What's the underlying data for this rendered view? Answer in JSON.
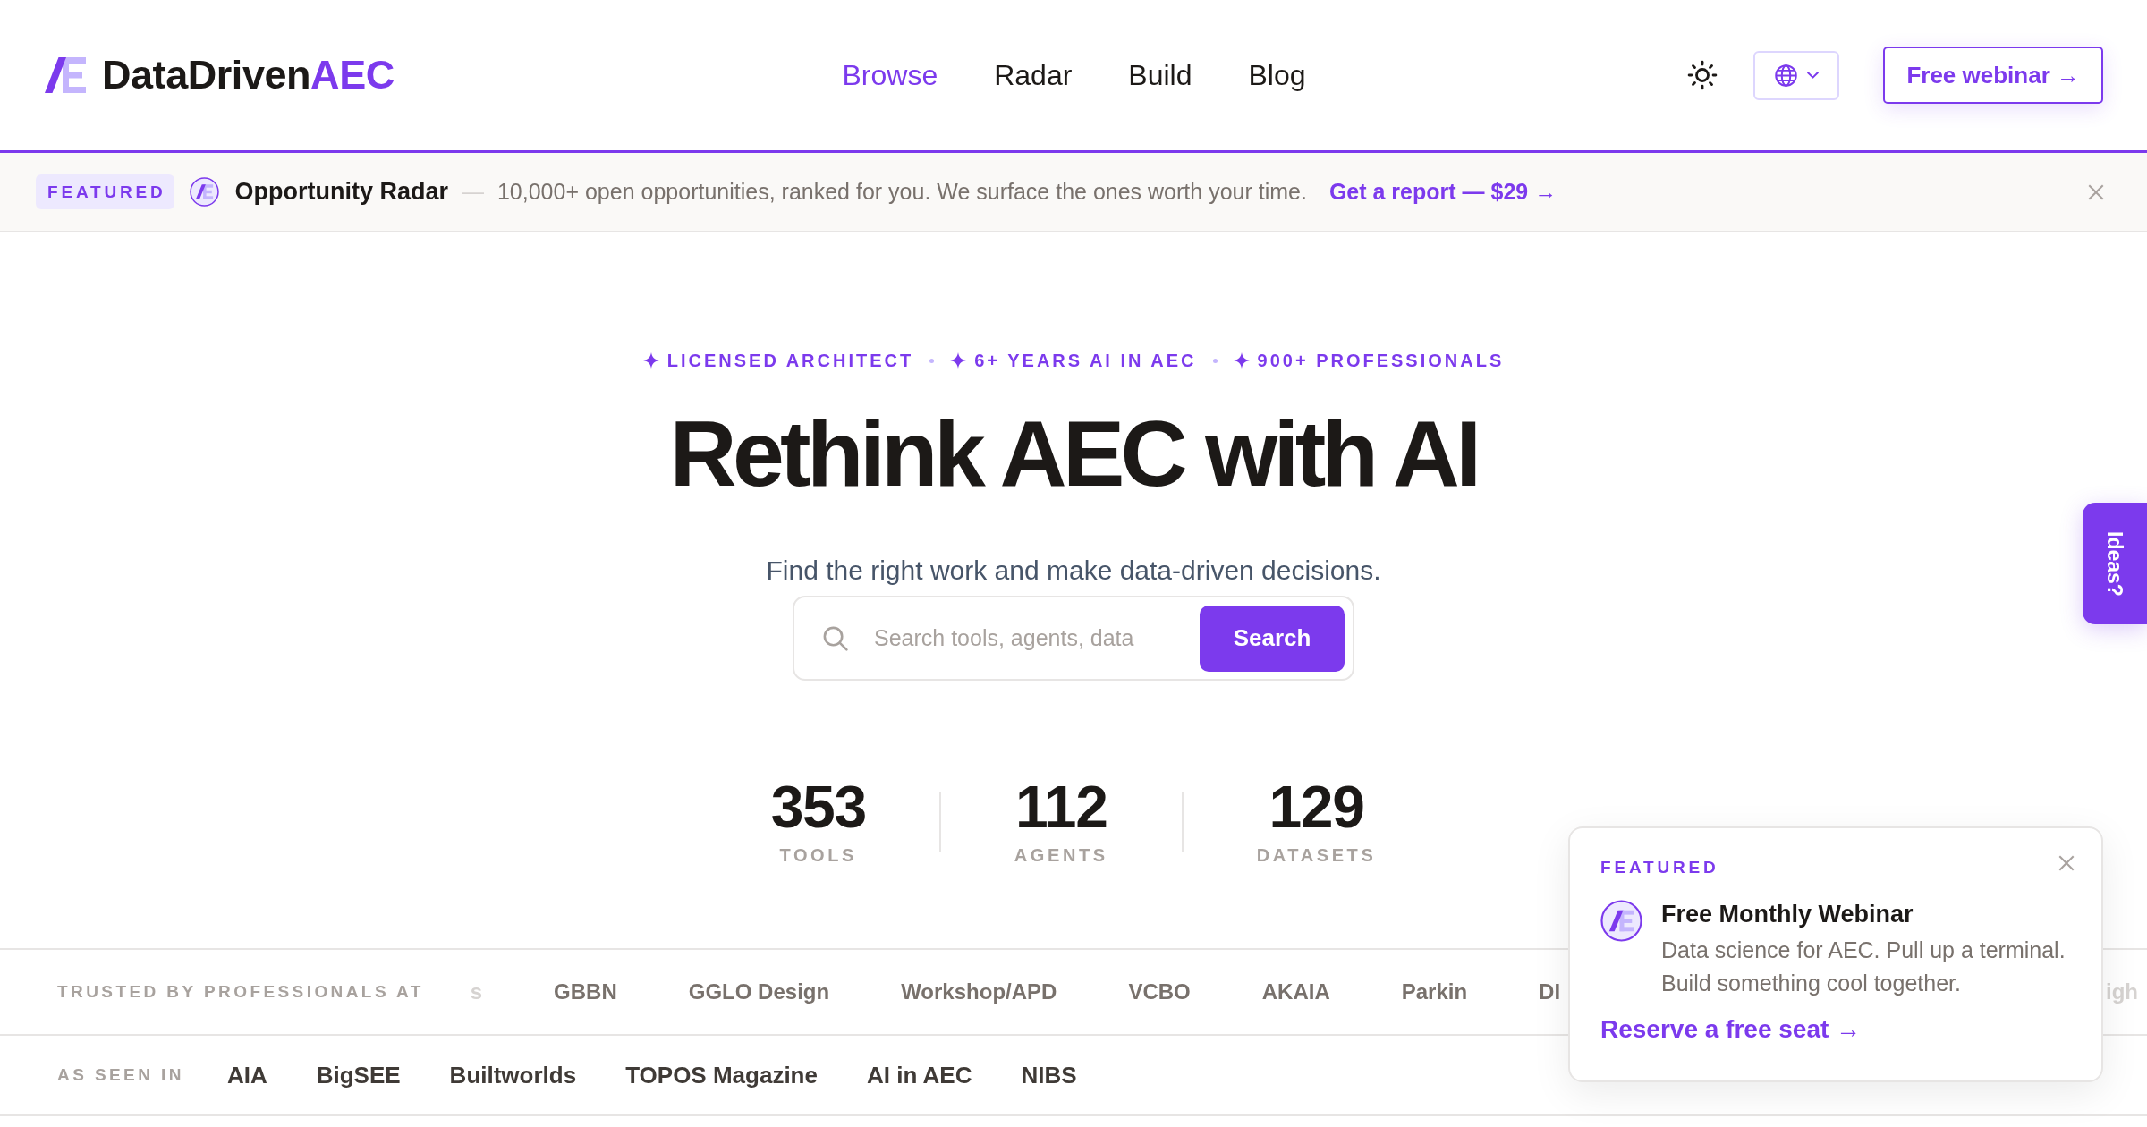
{
  "header": {
    "logo": {
      "name": "DataDriven",
      "accent": "AEC"
    },
    "nav": [
      {
        "label": "Browse",
        "selected": true
      },
      {
        "label": "Radar",
        "selected": false
      },
      {
        "label": "Build",
        "selected": false
      },
      {
        "label": "Blog",
        "selected": false
      }
    ],
    "cta": "Free webinar →"
  },
  "announcement": {
    "badge": "FEATURED",
    "title": "Opportunity Radar",
    "separator": "—",
    "text": "10,000+ open opportunities, ranked for you. We surface the ones worth your time.",
    "link": "Get a report — $29 →"
  },
  "hero": {
    "credentials": [
      "LICENSED ARCHITECT",
      "6+ YEARS AI IN AEC",
      "900+ PROFESSIONALS"
    ],
    "title": "Rethink AEC with AI",
    "subtitle": "Find the right work and make data-driven decisions.",
    "search": {
      "placeholder": "Search tools, agents, data",
      "button": "Search"
    }
  },
  "stats": [
    {
      "value": "353",
      "label": "TOOLS"
    },
    {
      "value": "112",
      "label": "AGENTS"
    },
    {
      "value": "129",
      "label": "DATASETS"
    }
  ],
  "trusted_by": {
    "label": "TRUSTED BY PROFESSIONALS AT",
    "logos": [
      {
        "name": "s",
        "faded": true
      },
      {
        "name": "GBBN",
        "faded": false
      },
      {
        "name": "GGLO Design",
        "faded": false
      },
      {
        "name": "Workshop/APD",
        "faded": false
      },
      {
        "name": "VCBO",
        "faded": false
      },
      {
        "name": "AKAIA",
        "faded": false
      },
      {
        "name": "Parkin",
        "faded": false
      },
      {
        "name": "DI",
        "faded": false
      },
      {
        "name": "igh",
        "faded": true
      }
    ]
  },
  "as_seen_in": {
    "label": "AS SEEN IN",
    "outlets": [
      "AIA",
      "BigSEE",
      "Builtworlds",
      "TOPOS Magazine",
      "AI in AEC",
      "NIBS"
    ]
  },
  "ideas_tab": {
    "label": "Ideas?"
  },
  "popup": {
    "eyebrow": "FEATURED",
    "title": "Free Monthly Webinar",
    "text": "Data science for AEC. Pull up a terminal. Build something cool together.",
    "link": "Reserve a free seat →"
  }
}
